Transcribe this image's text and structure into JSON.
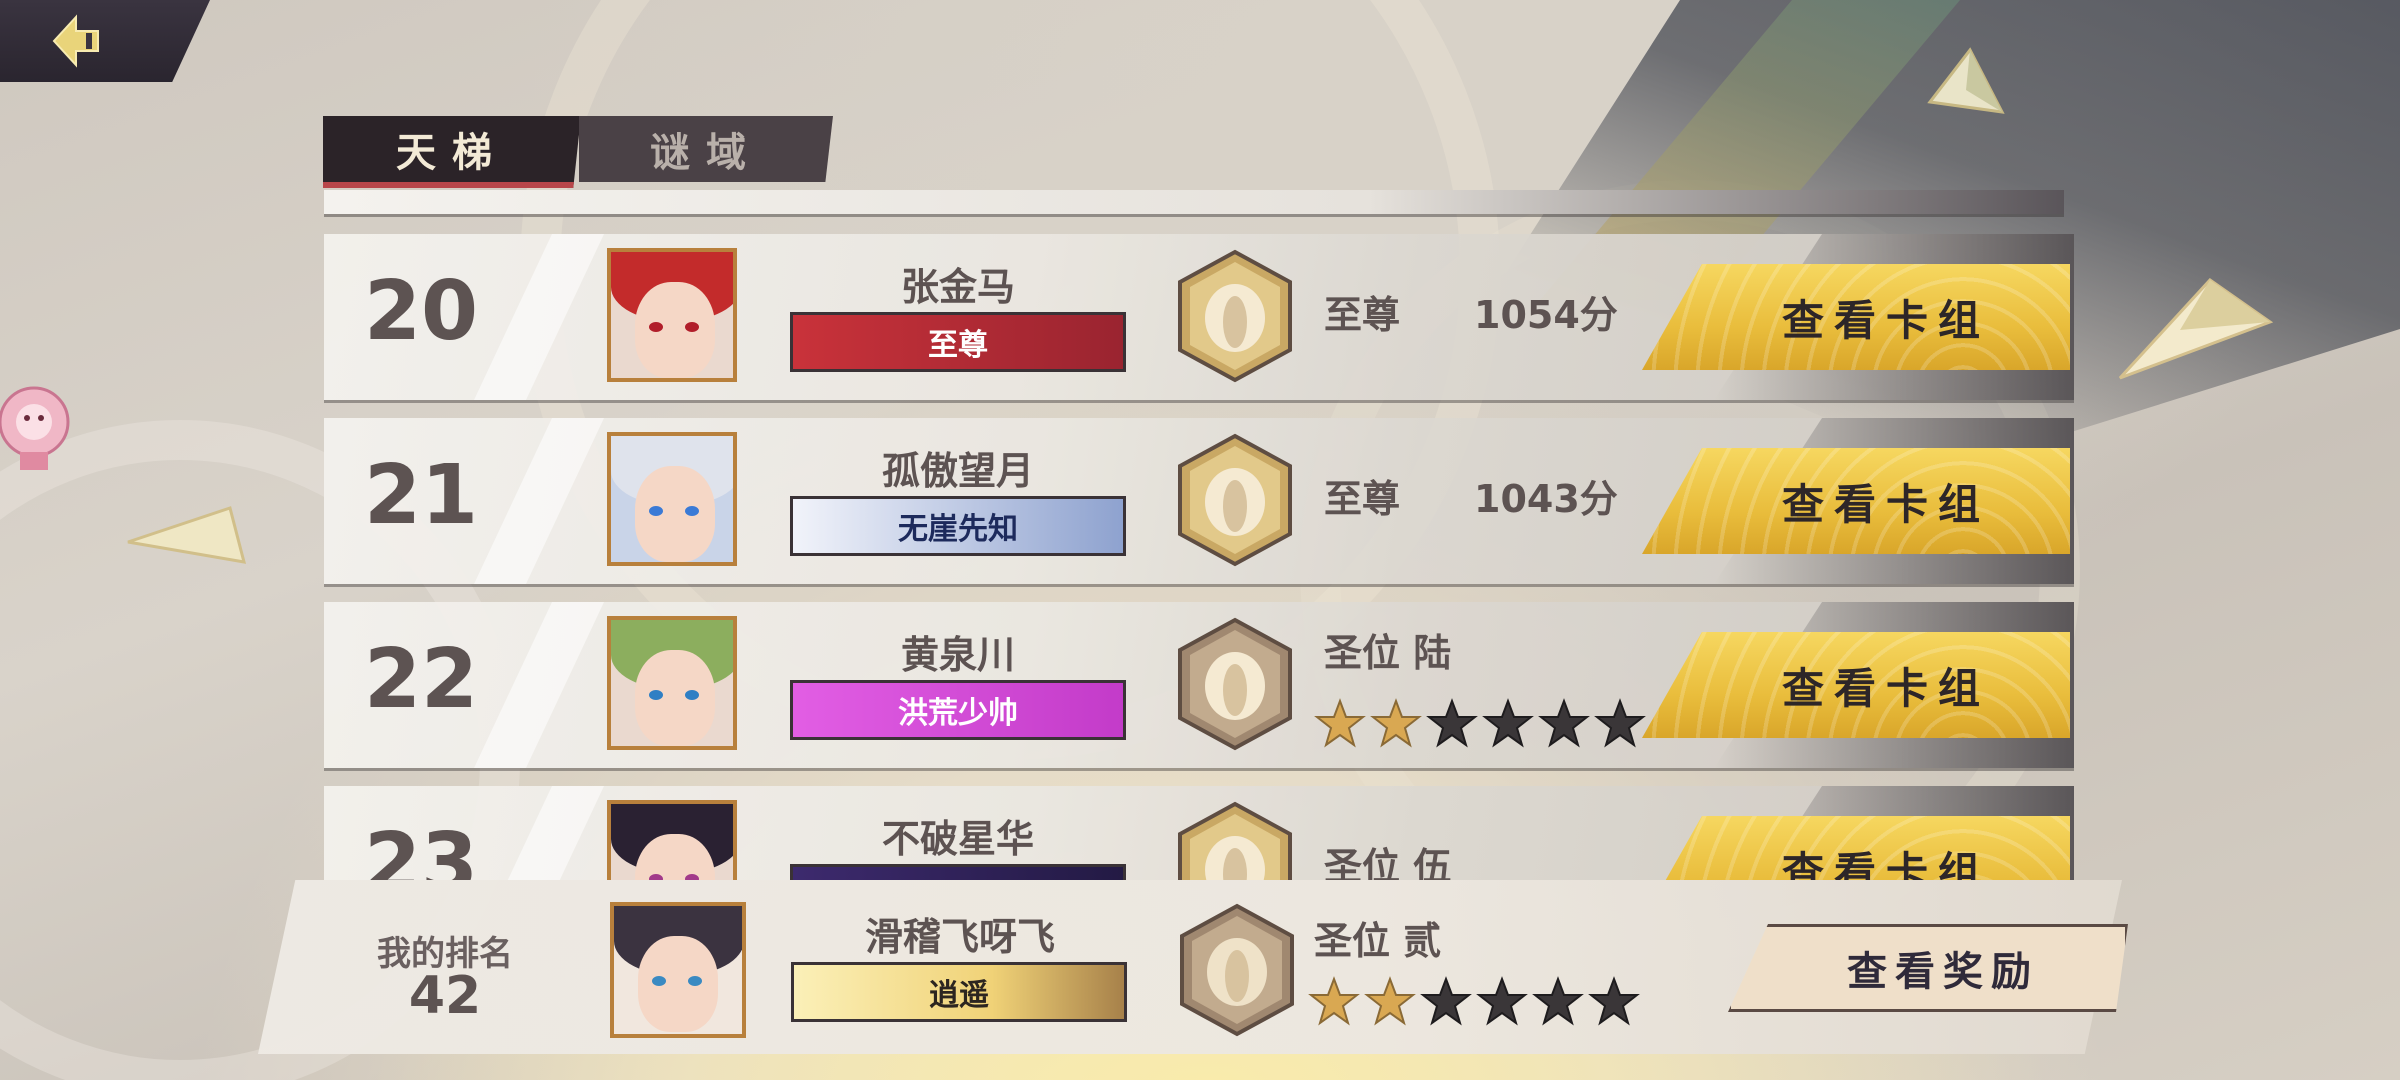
{
  "tabs": [
    {
      "label": "天梯",
      "active": true
    },
    {
      "label": "谜域",
      "active": false
    }
  ],
  "rows": [
    {
      "rank": "20",
      "name": "张金马",
      "title": "至尊",
      "title_colors": [
        "#c9323a",
        "#9a2430"
      ],
      "title_text_color": "#ffffff",
      "tier": "至尊",
      "score": "1054分",
      "stars": null,
      "button": "查看卡组",
      "hair_color": "#c32b2b",
      "eye_color": "#b11e2a"
    },
    {
      "rank": "21",
      "name": "孤傲望月",
      "title": "无崖先知",
      "title_colors": [
        "#f1f3fa",
        "#8ea2cf"
      ],
      "title_text_color": "#1d2a5c",
      "tier": "至尊",
      "score": "1043分",
      "stars": null,
      "button": "查看卡组",
      "hair_color": "#dfe3ec",
      "eye_color": "#3a7ad6"
    },
    {
      "rank": "22",
      "name": "黄泉川",
      "title": "洪荒少帅",
      "title_colors": [
        "#e25ee4",
        "#c33bc9"
      ],
      "title_text_color": "#ffffff",
      "tier": "圣位 陆",
      "score": null,
      "stars": {
        "filled": 2,
        "total": 6
      },
      "button": "查看卡组",
      "hair_color": "#8cae5e",
      "eye_color": "#2f7fc4"
    },
    {
      "rank": "23",
      "name": "不破星华",
      "title": "",
      "title_colors": [
        "#3d2a6e",
        "#231a44"
      ],
      "title_text_color": "#ffffff",
      "tier": "圣位 伍",
      "score": null,
      "stars": null,
      "button": "查看卡组",
      "hair_color": "#2a2132",
      "eye_color": "#a23a8a"
    }
  ],
  "my_rank": {
    "label": "我的排名",
    "rank": "42",
    "name": "滑稽飞呀飞",
    "title": "逍遥",
    "tier": "圣位 贰",
    "stars": {
      "filled": 2,
      "total": 6
    },
    "button": "查看奖励"
  },
  "colors": {
    "gold_button": "#e9bd3c",
    "tab_active_bg": "#2b2328",
    "tab_underline": "#b8464a",
    "text_dark": "#5d5352",
    "star_filled": "#d9a852",
    "star_empty": "#3a3638"
  },
  "icons": [
    "back-arrow-icon",
    "tier-medal-icon",
    "star-icon"
  ]
}
